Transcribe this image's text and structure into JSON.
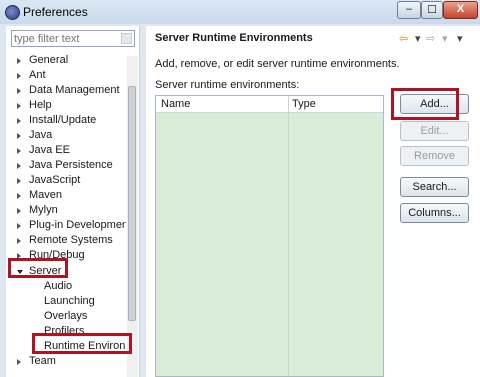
{
  "window": {
    "title": "Preferences",
    "minimize_glyph": "–",
    "maximize_glyph": "☐",
    "close_glyph": "X"
  },
  "filter": {
    "placeholder": "type filter text"
  },
  "tree": [
    {
      "label": "General",
      "state": "collapsed"
    },
    {
      "label": "Ant",
      "state": "collapsed"
    },
    {
      "label": "Data Management",
      "state": "collapsed"
    },
    {
      "label": "Help",
      "state": "collapsed"
    },
    {
      "label": "Install/Update",
      "state": "collapsed"
    },
    {
      "label": "Java",
      "state": "collapsed"
    },
    {
      "label": "Java EE",
      "state": "collapsed"
    },
    {
      "label": "Java Persistence",
      "state": "collapsed"
    },
    {
      "label": "JavaScript",
      "state": "collapsed"
    },
    {
      "label": "Maven",
      "state": "collapsed"
    },
    {
      "label": "Mylyn",
      "state": "collapsed"
    },
    {
      "label": "Plug-in Development",
      "state": "collapsed"
    },
    {
      "label": "Remote Systems",
      "state": "collapsed"
    },
    {
      "label": "Run/Debug",
      "state": "collapsed"
    },
    {
      "label": "Server",
      "state": "expanded"
    },
    {
      "label": "Audio",
      "state": "leaf"
    },
    {
      "label": "Launching",
      "state": "leaf"
    },
    {
      "label": "Overlays",
      "state": "leaf"
    },
    {
      "label": "Profilers",
      "state": "leaf"
    },
    {
      "label": "Runtime Environm",
      "state": "leaf"
    },
    {
      "label": "Team",
      "state": "collapsed"
    }
  ],
  "page": {
    "title": "Server Runtime Environments",
    "nav": {
      "back": "⇦",
      "back_menu": "▾",
      "forward": "⇨",
      "forward_menu": "▾",
      "view_menu": "▾"
    },
    "description": "Add, remove, or edit server runtime environments.",
    "table_label": "Server runtime environments:",
    "columns": [
      "Name",
      "Type"
    ]
  },
  "buttons": {
    "add": "Add...",
    "edit": "Edit...",
    "remove": "Remove",
    "search": "Search...",
    "columns": "Columns..."
  },
  "colors": {
    "highlight": "#b01424",
    "table_bg": "#d8ecd8"
  }
}
